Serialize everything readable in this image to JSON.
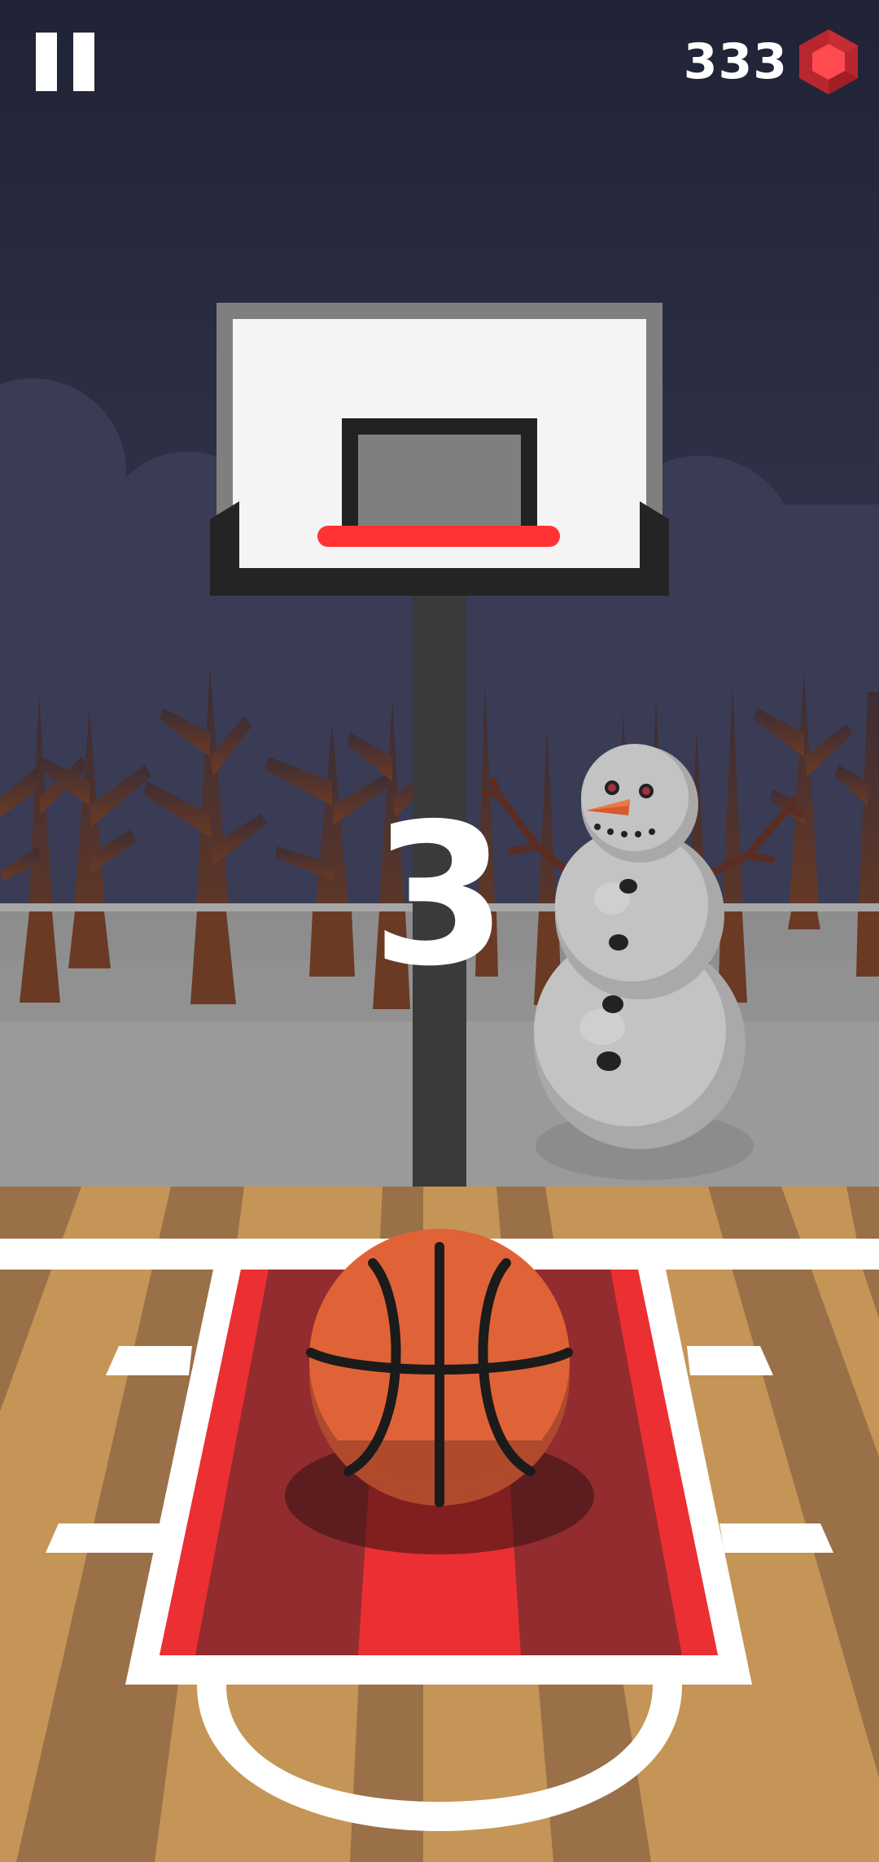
{
  "hud": {
    "pause_icon": "pause-icon",
    "score": "333",
    "currency_icon": "red-hexagon-gem-icon"
  },
  "countdown": {
    "value": "3"
  },
  "colors": {
    "sky_top": "#202235",
    "sky_bottom": "#3a3d55",
    "ground": "#9a9a9a",
    "court_wood_light": "#c49556",
    "court_wood_dark": "#9a7049",
    "key_paint_dark": "#922c2f",
    "key_paint_bright": "#ec2f33",
    "rim": "#ff3333",
    "ball": "#e06338",
    "gem": "#e8343c"
  }
}
